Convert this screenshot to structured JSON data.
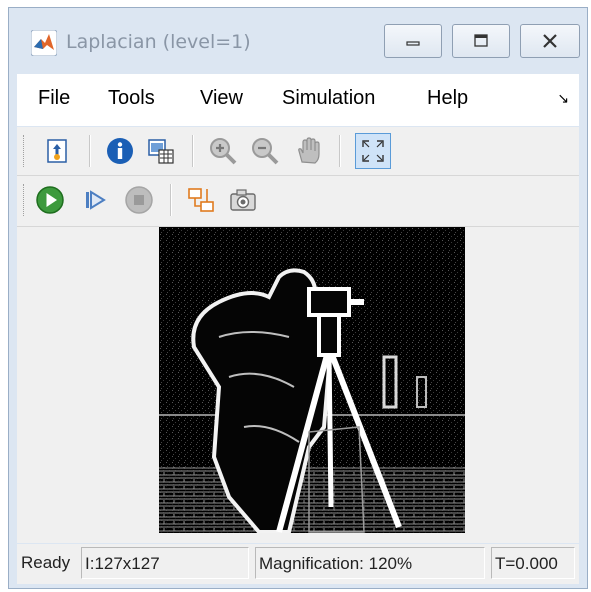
{
  "window": {
    "title": "Laplacian (level=1)",
    "accent_color": "#dce6f2"
  },
  "menu": {
    "items": [
      "File",
      "Tools",
      "View",
      "Simulation",
      "Help"
    ]
  },
  "toolbar1": {
    "icons": [
      "print-to-figure-icon",
      "info-icon",
      "export-to-workspace-icon",
      "zoom-in-icon",
      "zoom-out-icon",
      "pan-hand-icon",
      "fit-to-window-icon"
    ]
  },
  "toolbar2": {
    "icons": [
      "run-icon",
      "step-forward-icon",
      "stop-icon",
      "highlight-block-icon",
      "snapshot-camera-icon"
    ]
  },
  "status": {
    "ready": "Ready",
    "size": "I:127x127",
    "magnification": "Magnification: 120%",
    "time": "T=0.000"
  }
}
